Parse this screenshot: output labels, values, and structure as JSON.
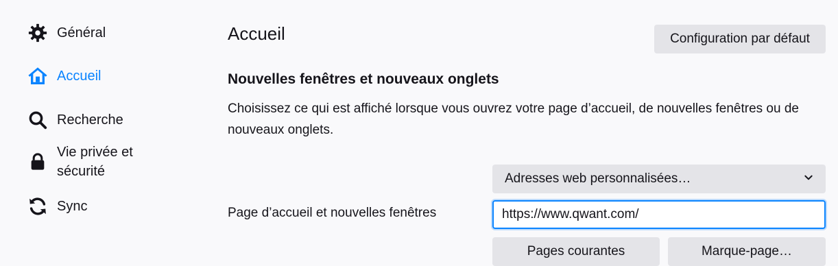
{
  "sidebar": {
    "items": [
      {
        "label": "Général",
        "icon": "gear-icon"
      },
      {
        "label": "Accueil",
        "icon": "home-icon"
      },
      {
        "label": "Recherche",
        "icon": "search-icon"
      },
      {
        "label": "Vie privée et sécurité",
        "icon": "lock-icon"
      },
      {
        "label": "Sync",
        "icon": "sync-icon"
      }
    ],
    "active_color": "#0a84ff"
  },
  "main": {
    "title": "Accueil",
    "default_button": "Configuration par défaut",
    "section": {
      "title": "Nouvelles fenêtres et nouveaux onglets",
      "description": "Choisissez ce qui est affiché lorsque vous ouvrez votre page d’accueil, de nouvelles fenêtres ou de nouveaux onglets."
    },
    "homepage": {
      "select_value": "Adresses web personnalisées…",
      "label": "Page d’accueil et nouvelles fenêtres",
      "url_value": "https://www.qwant.com/",
      "button_current_pages": "Pages courantes",
      "button_bookmark": "Marque-page…"
    }
  }
}
